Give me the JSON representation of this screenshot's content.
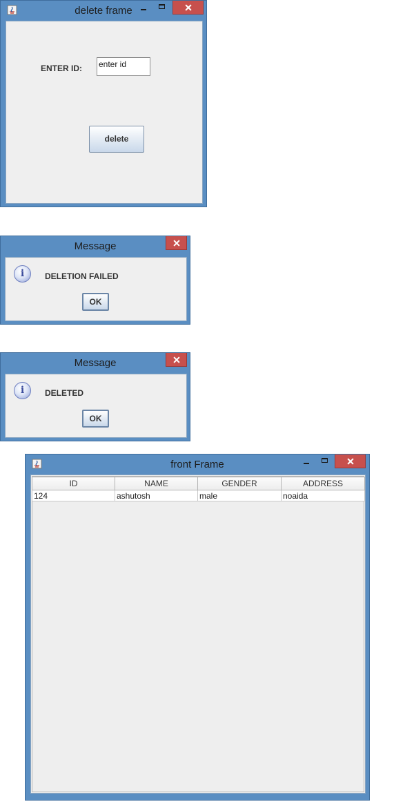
{
  "delete_frame": {
    "title": "delete frame",
    "id_label": "ENTER ID:",
    "id_field_value": "enter id",
    "delete_button": "delete"
  },
  "message_failed": {
    "title": "Message",
    "text": "DELETION FAILED",
    "ok_button": "OK",
    "icon": "info-icon"
  },
  "message_deleted": {
    "title": "Message",
    "text": "DELETED",
    "ok_button": "OK",
    "icon": "info-icon"
  },
  "front_frame": {
    "title": "front Frame",
    "table": {
      "columns": [
        "ID",
        "NAME",
        "GENDER",
        "ADDRESS"
      ],
      "rows": [
        [
          "124",
          "ashutosh",
          "male",
          "noaida"
        ]
      ]
    }
  },
  "colors": {
    "titlebar": "#5a8ec2",
    "close_button": "#c7504d",
    "client_bg": "#efefef"
  }
}
